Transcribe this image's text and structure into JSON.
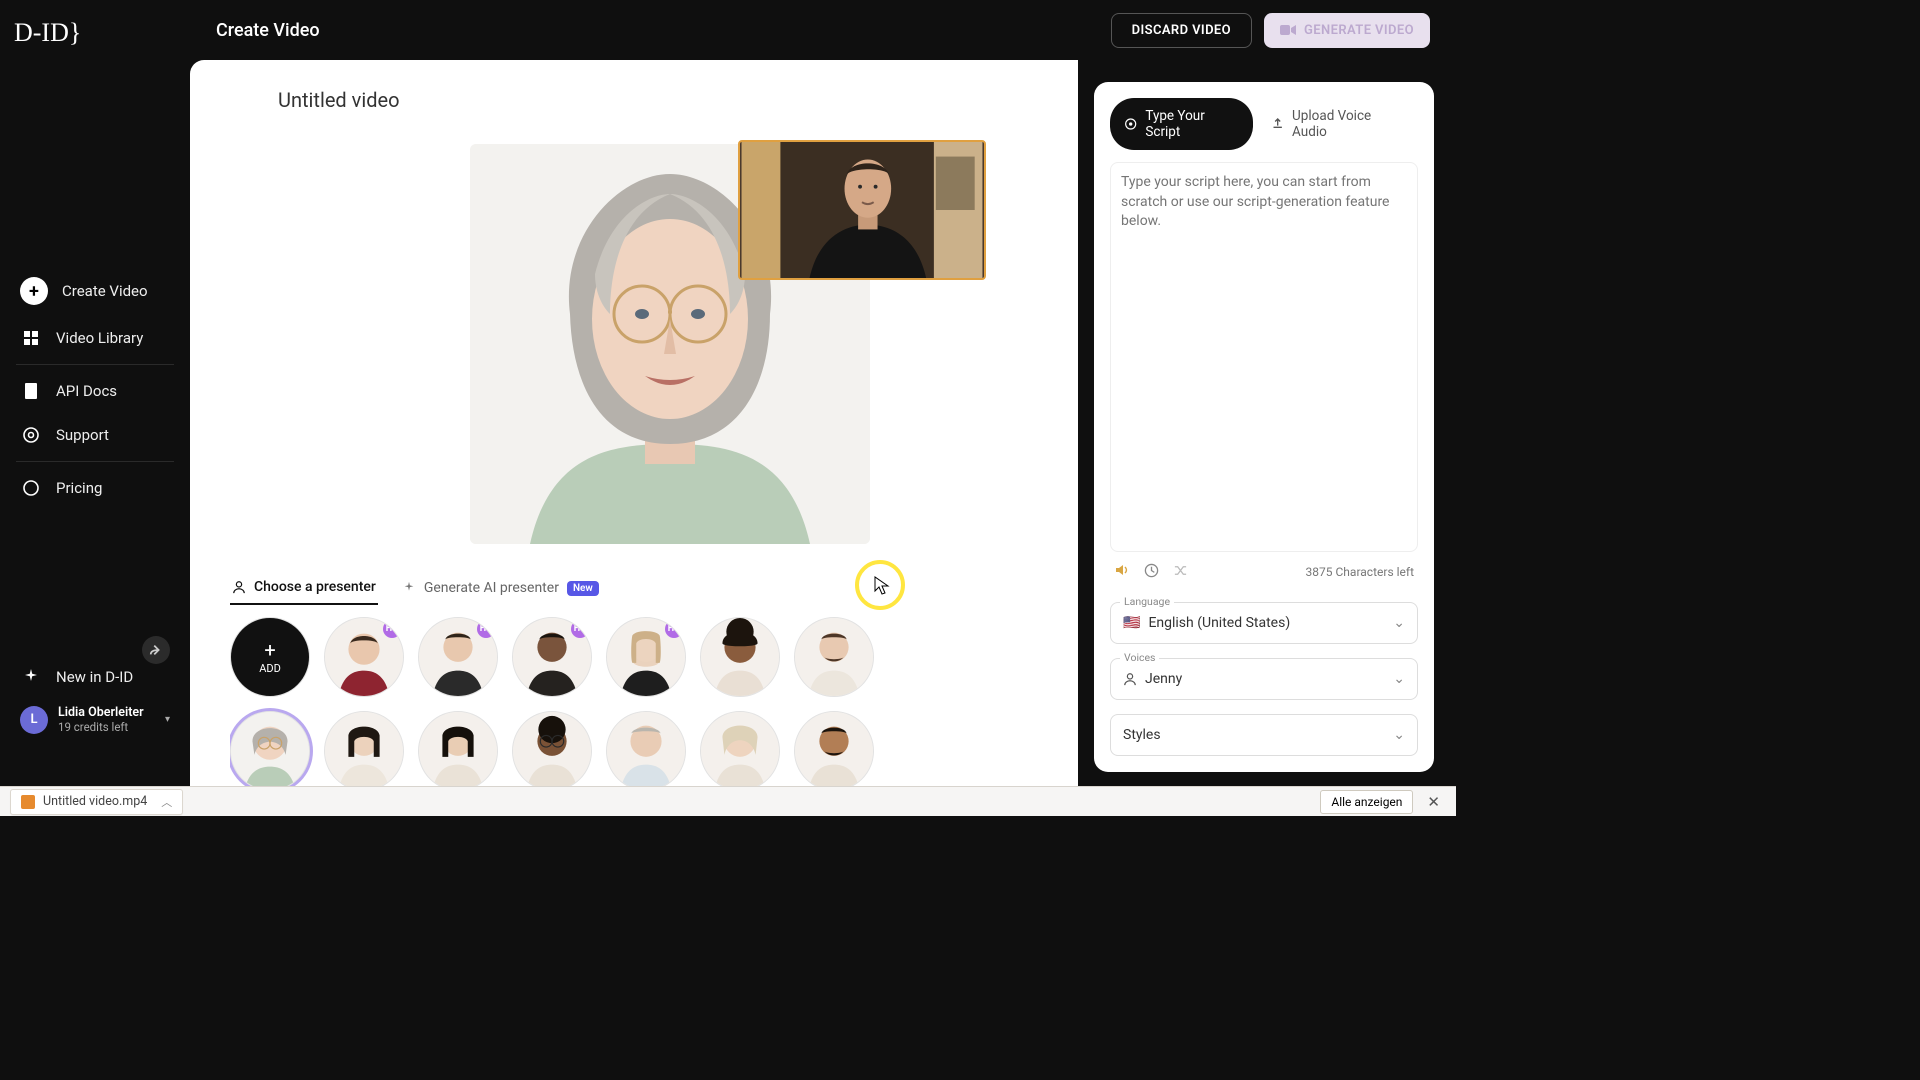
{
  "logo": "D-ID}",
  "header": {
    "title": "Create Video",
    "discard": "DISCARD VIDEO",
    "generate": "GENERATE VIDEO"
  },
  "sidebar": {
    "items": [
      {
        "label": "Create Video"
      },
      {
        "label": "Video Library"
      },
      {
        "label": "API Docs"
      },
      {
        "label": "Support"
      },
      {
        "label": "Pricing"
      }
    ],
    "new": "New in D-ID",
    "user": {
      "initial": "L",
      "name": "Lidia Oberleiter",
      "credits": "19 credits left"
    }
  },
  "main": {
    "videoTitle": "Untitled video",
    "tabs": {
      "choose": "Choose a presenter",
      "generate": "Generate AI presenter",
      "newBadge": "New"
    },
    "addLabel": "ADD",
    "hq": "HQ"
  },
  "script": {
    "tabType": "Type Your Script",
    "tabUpload": "Upload Voice Audio",
    "placeholder": "Type your script here, you can start from scratch or use our script-generation feature below.",
    "charsLeft": "3875 Characters left",
    "language": {
      "label": "Language",
      "value": "English (United States)",
      "flag": "🇺🇸"
    },
    "voices": {
      "label": "Voices",
      "value": "Jenny"
    },
    "styles": {
      "label": "Styles",
      "value": "Styles"
    }
  },
  "download": {
    "file": "Untitled video.mp4",
    "showAll": "Alle anzeigen"
  }
}
